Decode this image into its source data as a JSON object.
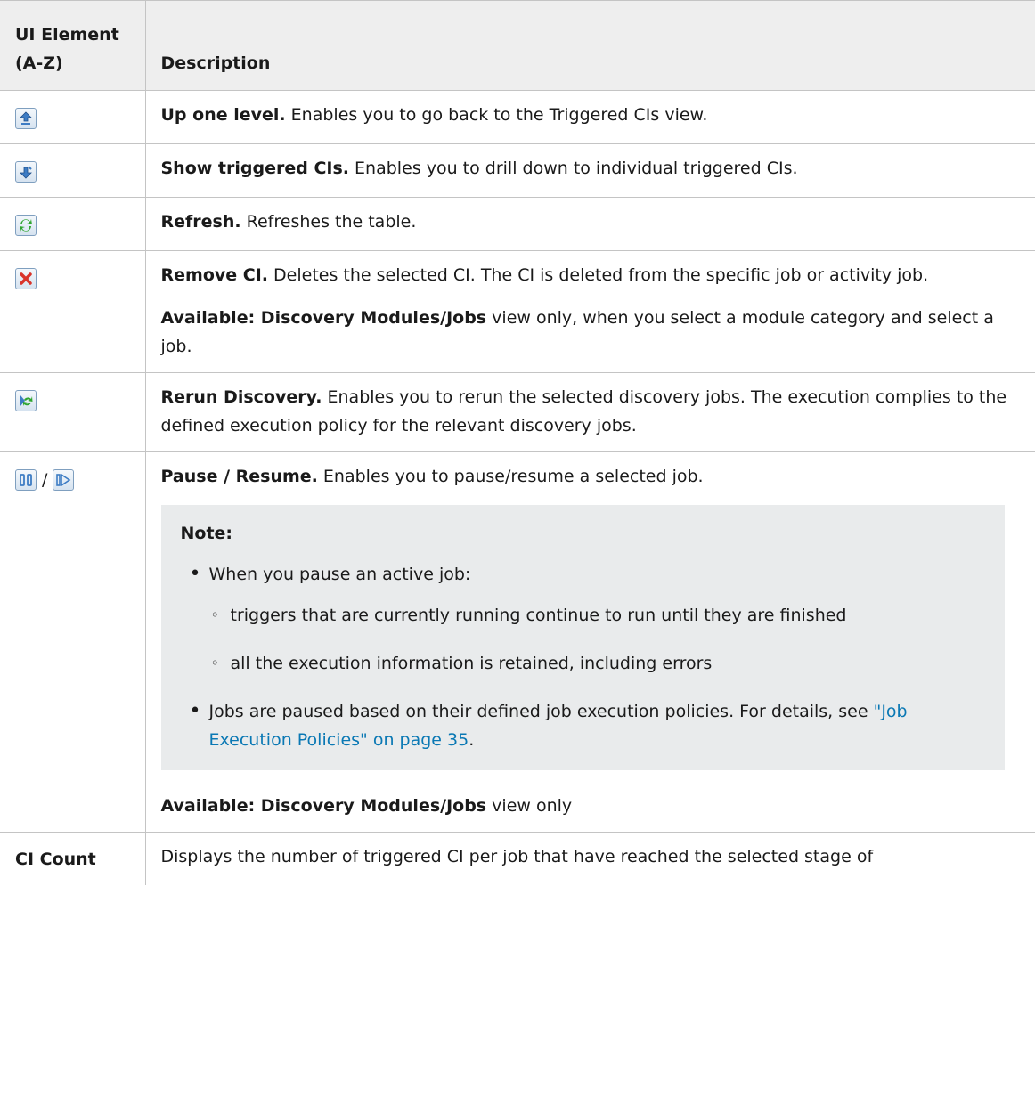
{
  "table": {
    "header": {
      "col1": "UI Element (A-Z)",
      "col2": "Description"
    },
    "rows": [
      {
        "icon": "up-one-level-icon",
        "title": "Up one level.",
        "text": " Enables you to go back to the Triggered CIs view."
      },
      {
        "icon": "show-triggered-cis-icon",
        "title": "Show triggered CIs.",
        "text": " Enables you to drill down to individual triggered CIs."
      },
      {
        "icon": "refresh-icon",
        "title": "Refresh.",
        "text": " Refreshes the table."
      },
      {
        "icon": "remove-ci-icon",
        "title": "Remove CI.",
        "text": " Deletes the selected CI. The CI is deleted from the specific job or activity job.",
        "available_label": "Available: Discovery Modules/Jobs",
        "available_text": " view only, when you select a module category and select a job."
      },
      {
        "icon": "rerun-discovery-icon",
        "title": "Rerun Discovery.",
        "text": " Enables you to rerun the selected discovery jobs. The execution complies to the defined execution policy for the relevant discovery jobs."
      },
      {
        "icon": "pause-icon",
        "icon2": "resume-icon",
        "separator": "/",
        "title": "Pause / Resume.",
        "text": " Enables you to pause/resume a selected job.",
        "note": {
          "title": "Note:",
          "bullet1": "When you pause an active job:",
          "sub1": "triggers that are currently running continue to run until they are finished",
          "sub2": "all the execution information is retained, including errors",
          "bullet2": "Jobs are paused based on their defined job execution policies. For details, see ",
          "link": "\"Job Execution Policies\" on page 35",
          "link_suffix": "."
        },
        "available_label": "Available: Discovery Modules/Jobs",
        "available_text": " view only"
      },
      {
        "label": "CI Count",
        "text": "Displays the number of triggered CI per job that have reached the selected stage of"
      }
    ]
  }
}
